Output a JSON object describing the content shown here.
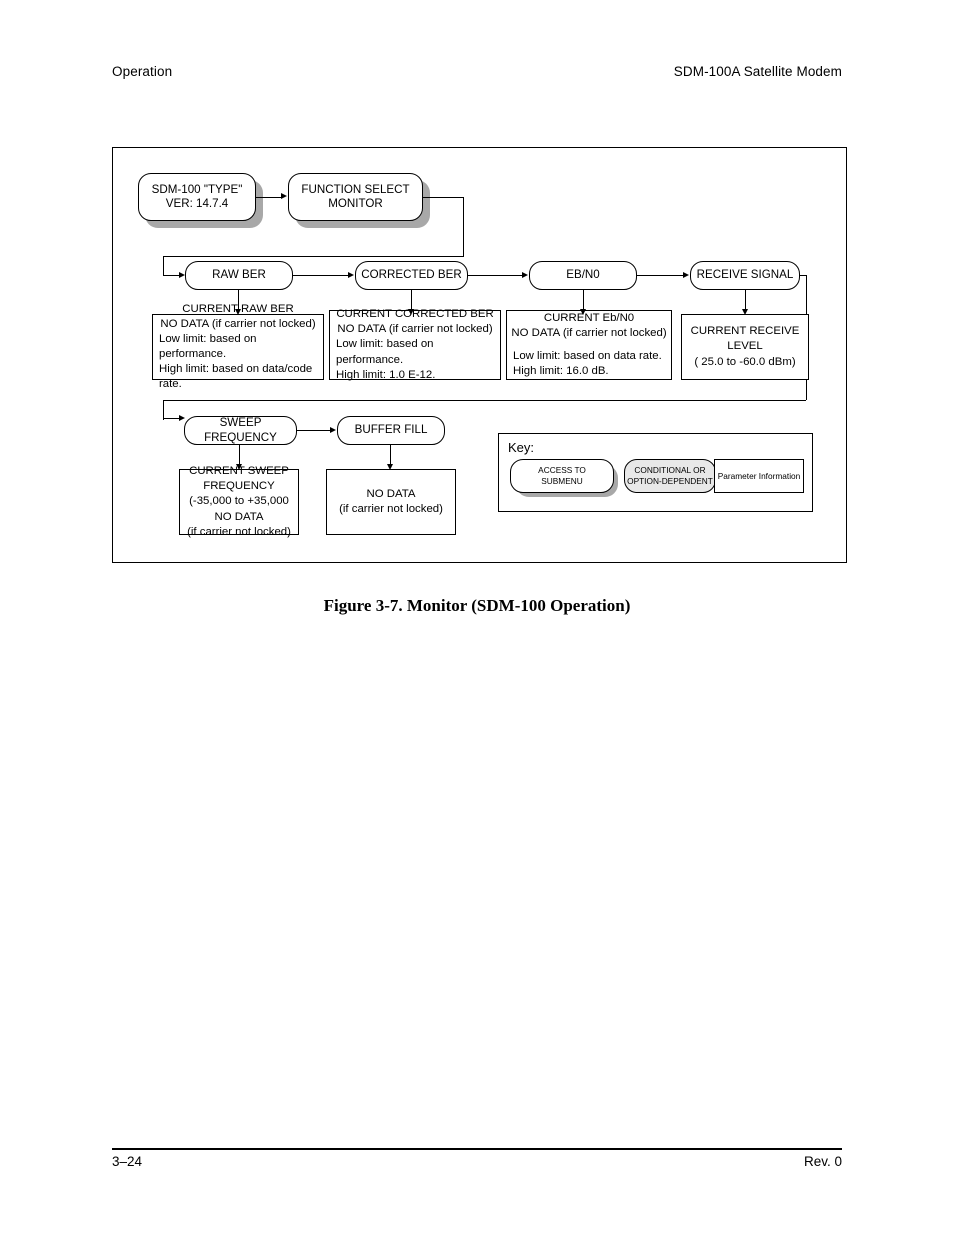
{
  "header": {
    "left": "Operation",
    "right": "SDM-100A Satellite Modem"
  },
  "footer": {
    "page": "3–24",
    "revision": "Rev. 0"
  },
  "caption": "Figure 3-7.  Monitor (SDM-100 Operation)",
  "flow": {
    "nodes": {
      "title": {
        "line1": "SDM-100 \"TYPE\"",
        "line2": "VER: 14.7.4"
      },
      "function_select": {
        "line1": "FUNCTION SELECT",
        "line2": "MONITOR"
      },
      "raw_ber": "RAW BER",
      "corrected_ber": "CORRECTED BER",
      "ebn0": "EB/N0",
      "receive_signal": "RECEIVE SIGNAL",
      "sweep_frequency": "SWEEP FREQUENCY",
      "buffer_fill": "BUFFER FILL"
    },
    "params": {
      "raw_ber": {
        "line1": "CURRENT RAW BER",
        "line2": "NO DATA (if carrier not locked)",
        "line3": "Low limit: based on performance.",
        "line4": "High limit: based on data/code rate."
      },
      "corrected_ber": {
        "line1": "CURRENT CORRECTED BER",
        "line2": "NO DATA (if carrier not locked)",
        "line3": "Low limit: based on performance.",
        "line4": "High limit: 1.0 E-12."
      },
      "ebn0": {
        "line1": "CURRENT  Eb/N0",
        "line2": "NO DATA (if carrier not locked)",
        "line3": "Low limit: based on data rate.",
        "line4": "High limit: 16.0 dB."
      },
      "receive_signal": {
        "line1": "CURRENT RECEIVE",
        "line2": "LEVEL",
        "line3": "( 25.0 to -60.0 dBm)"
      },
      "sweep_frequency": {
        "line1": "CURRENT SWEEP",
        "line2": "FREQUENCY",
        "line3": "(-35,000 to +35,000",
        "line4": "NO DATA",
        "line5": "(if carrier not locked)"
      },
      "buffer_fill": {
        "line1": "NO DATA",
        "line2": "(if carrier not locked)"
      }
    }
  },
  "key": {
    "label": "Key:",
    "access_submenu": {
      "line1": "ACCESS TO",
      "line2": "SUBMENU"
    },
    "conditional": {
      "line1": "CONDITIONAL OR",
      "line2": "OPTION-DEPENDENT"
    },
    "parameter": "Parameter Information"
  },
  "colors": {
    "shadow": "#a8a8a8",
    "conditional_fill": "#e8e8e8",
    "line": "#000000"
  }
}
